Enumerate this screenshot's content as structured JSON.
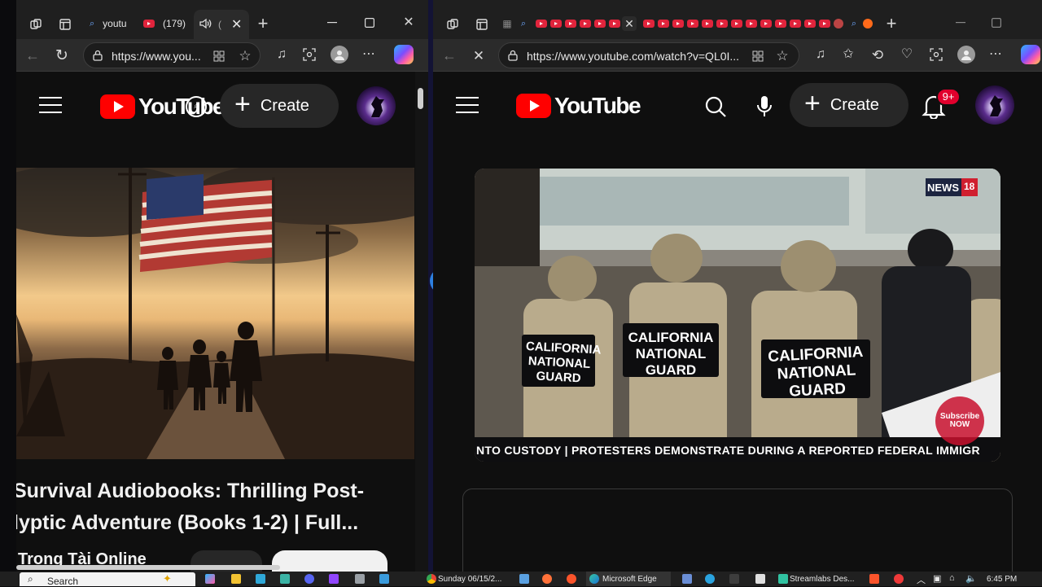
{
  "left_window": {
    "tabs": [
      {
        "label": "youtu",
        "favicon": "search-icon"
      },
      {
        "label": "(179)",
        "favicon": "youtube-icon"
      },
      {
        "label": "(",
        "favicon": "speaker-icon"
      }
    ],
    "address": "https://www.you...",
    "youtube": {
      "logo_text": "YouTube",
      "create_label": "Create",
      "video_title_line1": "Survival Audiobooks: Thrilling Post-",
      "video_title_line2": "lyptic Adventure (Books 1-2) | Full...",
      "channel_name": "Trong Tài Online"
    }
  },
  "right_window": {
    "address": "https://www.youtube.com/watch?v=QL0I...",
    "youtube": {
      "logo_text": "YouTube",
      "create_label": "Create",
      "notification_badge": "9+",
      "news_logo": "NEWS",
      "news_logo_num": "18",
      "shield_text_1a": "CALIFORNIA",
      "shield_text_1b": "NATIONAL GUARD",
      "shield_text_2a": "CALIFORNIA",
      "shield_text_2b": "NATIONAL GUARD",
      "shield_text_3a": "CALIFORNIA",
      "shield_text_3b": "NATIONAL GUARD",
      "subscribe_badge_1": "Subscribe",
      "subscribe_badge_2": "NOW",
      "ticker": "NTO CUSTODY | PROTESTERS DEMONSTRATE DURING A REPORTED FEDERAL IMMIGR"
    }
  },
  "taskbar": {
    "search_label": "Search",
    "chrome_item": "Sunday 06/15/2...",
    "edge_item": "Microsoft Edge",
    "streamlabs_item": "Streamlabs Des...",
    "clock": "6:45 PM"
  },
  "colors": {
    "youtube_red": "#ff0000",
    "dark_bg": "#0f0f0f",
    "tab_red": "#e1243c"
  }
}
